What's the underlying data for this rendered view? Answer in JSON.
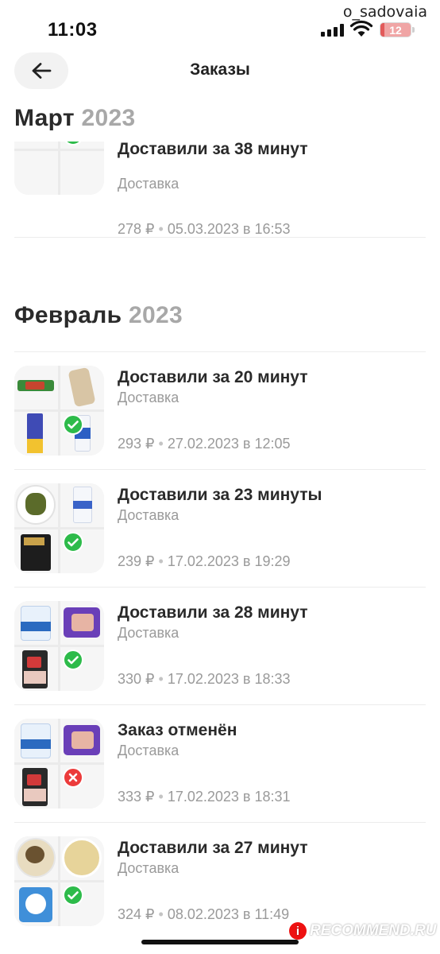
{
  "status_bar": {
    "time": "11:03",
    "battery": "12",
    "battery_percent": 12,
    "watermark_user": "o_sadovaia"
  },
  "header": {
    "title": "Заказы",
    "back_icon": "arrow-left-icon"
  },
  "sections": [
    {
      "month": "Март",
      "year": "2023",
      "orders": [
        {
          "title": "Доставили за 38 минут",
          "type": "Доставка",
          "price": "278 ₽",
          "date": "05.03.2023 в 16:53",
          "status": "delivered"
        }
      ]
    },
    {
      "month": "Февраль",
      "year": "2023",
      "orders": [
        {
          "title": "Доставили за 20 минут",
          "type": "Доставка",
          "price": "293 ₽",
          "date": "27.02.2023 в 12:05",
          "status": "delivered"
        },
        {
          "title": "Доставили за 23 минуты",
          "type": "Доставка",
          "price": "239 ₽",
          "date": "17.02.2023 в 19:29",
          "status": "delivered"
        },
        {
          "title": "Доставили за 28 минут",
          "type": "Доставка",
          "price": "330 ₽",
          "date": "17.02.2023 в 18:33",
          "status": "delivered"
        },
        {
          "title": "Заказ отменён",
          "type": "Доставка",
          "price": "333 ₽",
          "date": "17.02.2023 в 18:31",
          "status": "cancelled"
        },
        {
          "title": "Доставили за 27 минут",
          "type": "Доставка",
          "price": "324 ₽",
          "date": "08.02.2023 в 11:49",
          "status": "delivered"
        }
      ]
    }
  ],
  "watermark": "RECOMMEND.RU",
  "watermark_badge": "i",
  "colors": {
    "delivered": "#2dbb4a",
    "cancelled": "#ec3b3b",
    "muted_text": "#9a9a9a",
    "year_text": "#a8a8a8"
  }
}
